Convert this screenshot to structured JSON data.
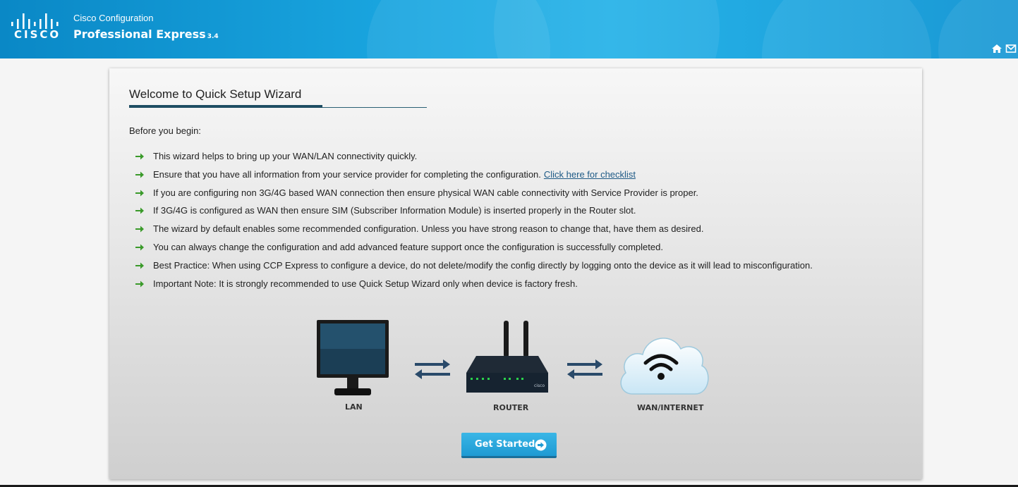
{
  "header": {
    "brand": "CISCO",
    "app_line1": "Cisco Configuration",
    "app_line2": "Professional Express",
    "version": "3.4",
    "icons": [
      "home-icon",
      "mail-icon"
    ]
  },
  "panel": {
    "title": "Welcome to Quick Setup Wizard",
    "intro": "Before you begin:",
    "bullets": [
      "This wizard helps to bring up your WAN/LAN connectivity quickly.",
      "Ensure that you have all information from your service provider for completing the configuration.",
      "If you are configuring non 3G/4G based WAN connection then ensure physical WAN cable connectivity with Service Provider is proper.",
      "If 3G/4G is configured as WAN then ensure SIM (Subscriber Information Module) is inserted properly in the Router slot.",
      "The wizard by default enables some recommended configuration. Unless you have strong reason to change that, have them as desired.",
      "You can always change the configuration and add advanced feature support once the configuration is successfully completed.",
      "Best Practice: When using CCP Express to configure a device, do not delete/modify the config directly by logging onto the device as it will lead to misconfiguration.",
      "Important Note: It is strongly recommended to use Quick Setup Wizard only when device is factory fresh."
    ],
    "checklist_link": "Click here for checklist",
    "diagram": {
      "lan_label": "LAN",
      "router_label": "ROUTER",
      "wan_label": "WAN/INTERNET",
      "router_brand": "cisco"
    },
    "button_label": "Get Started"
  },
  "colors": {
    "header_blue": "#1aa6e0",
    "bullet_green": "#3a9a2a",
    "link_blue": "#1e5a86",
    "title_rule": "#1e4d63",
    "button_blue": "#1e9ad3"
  }
}
